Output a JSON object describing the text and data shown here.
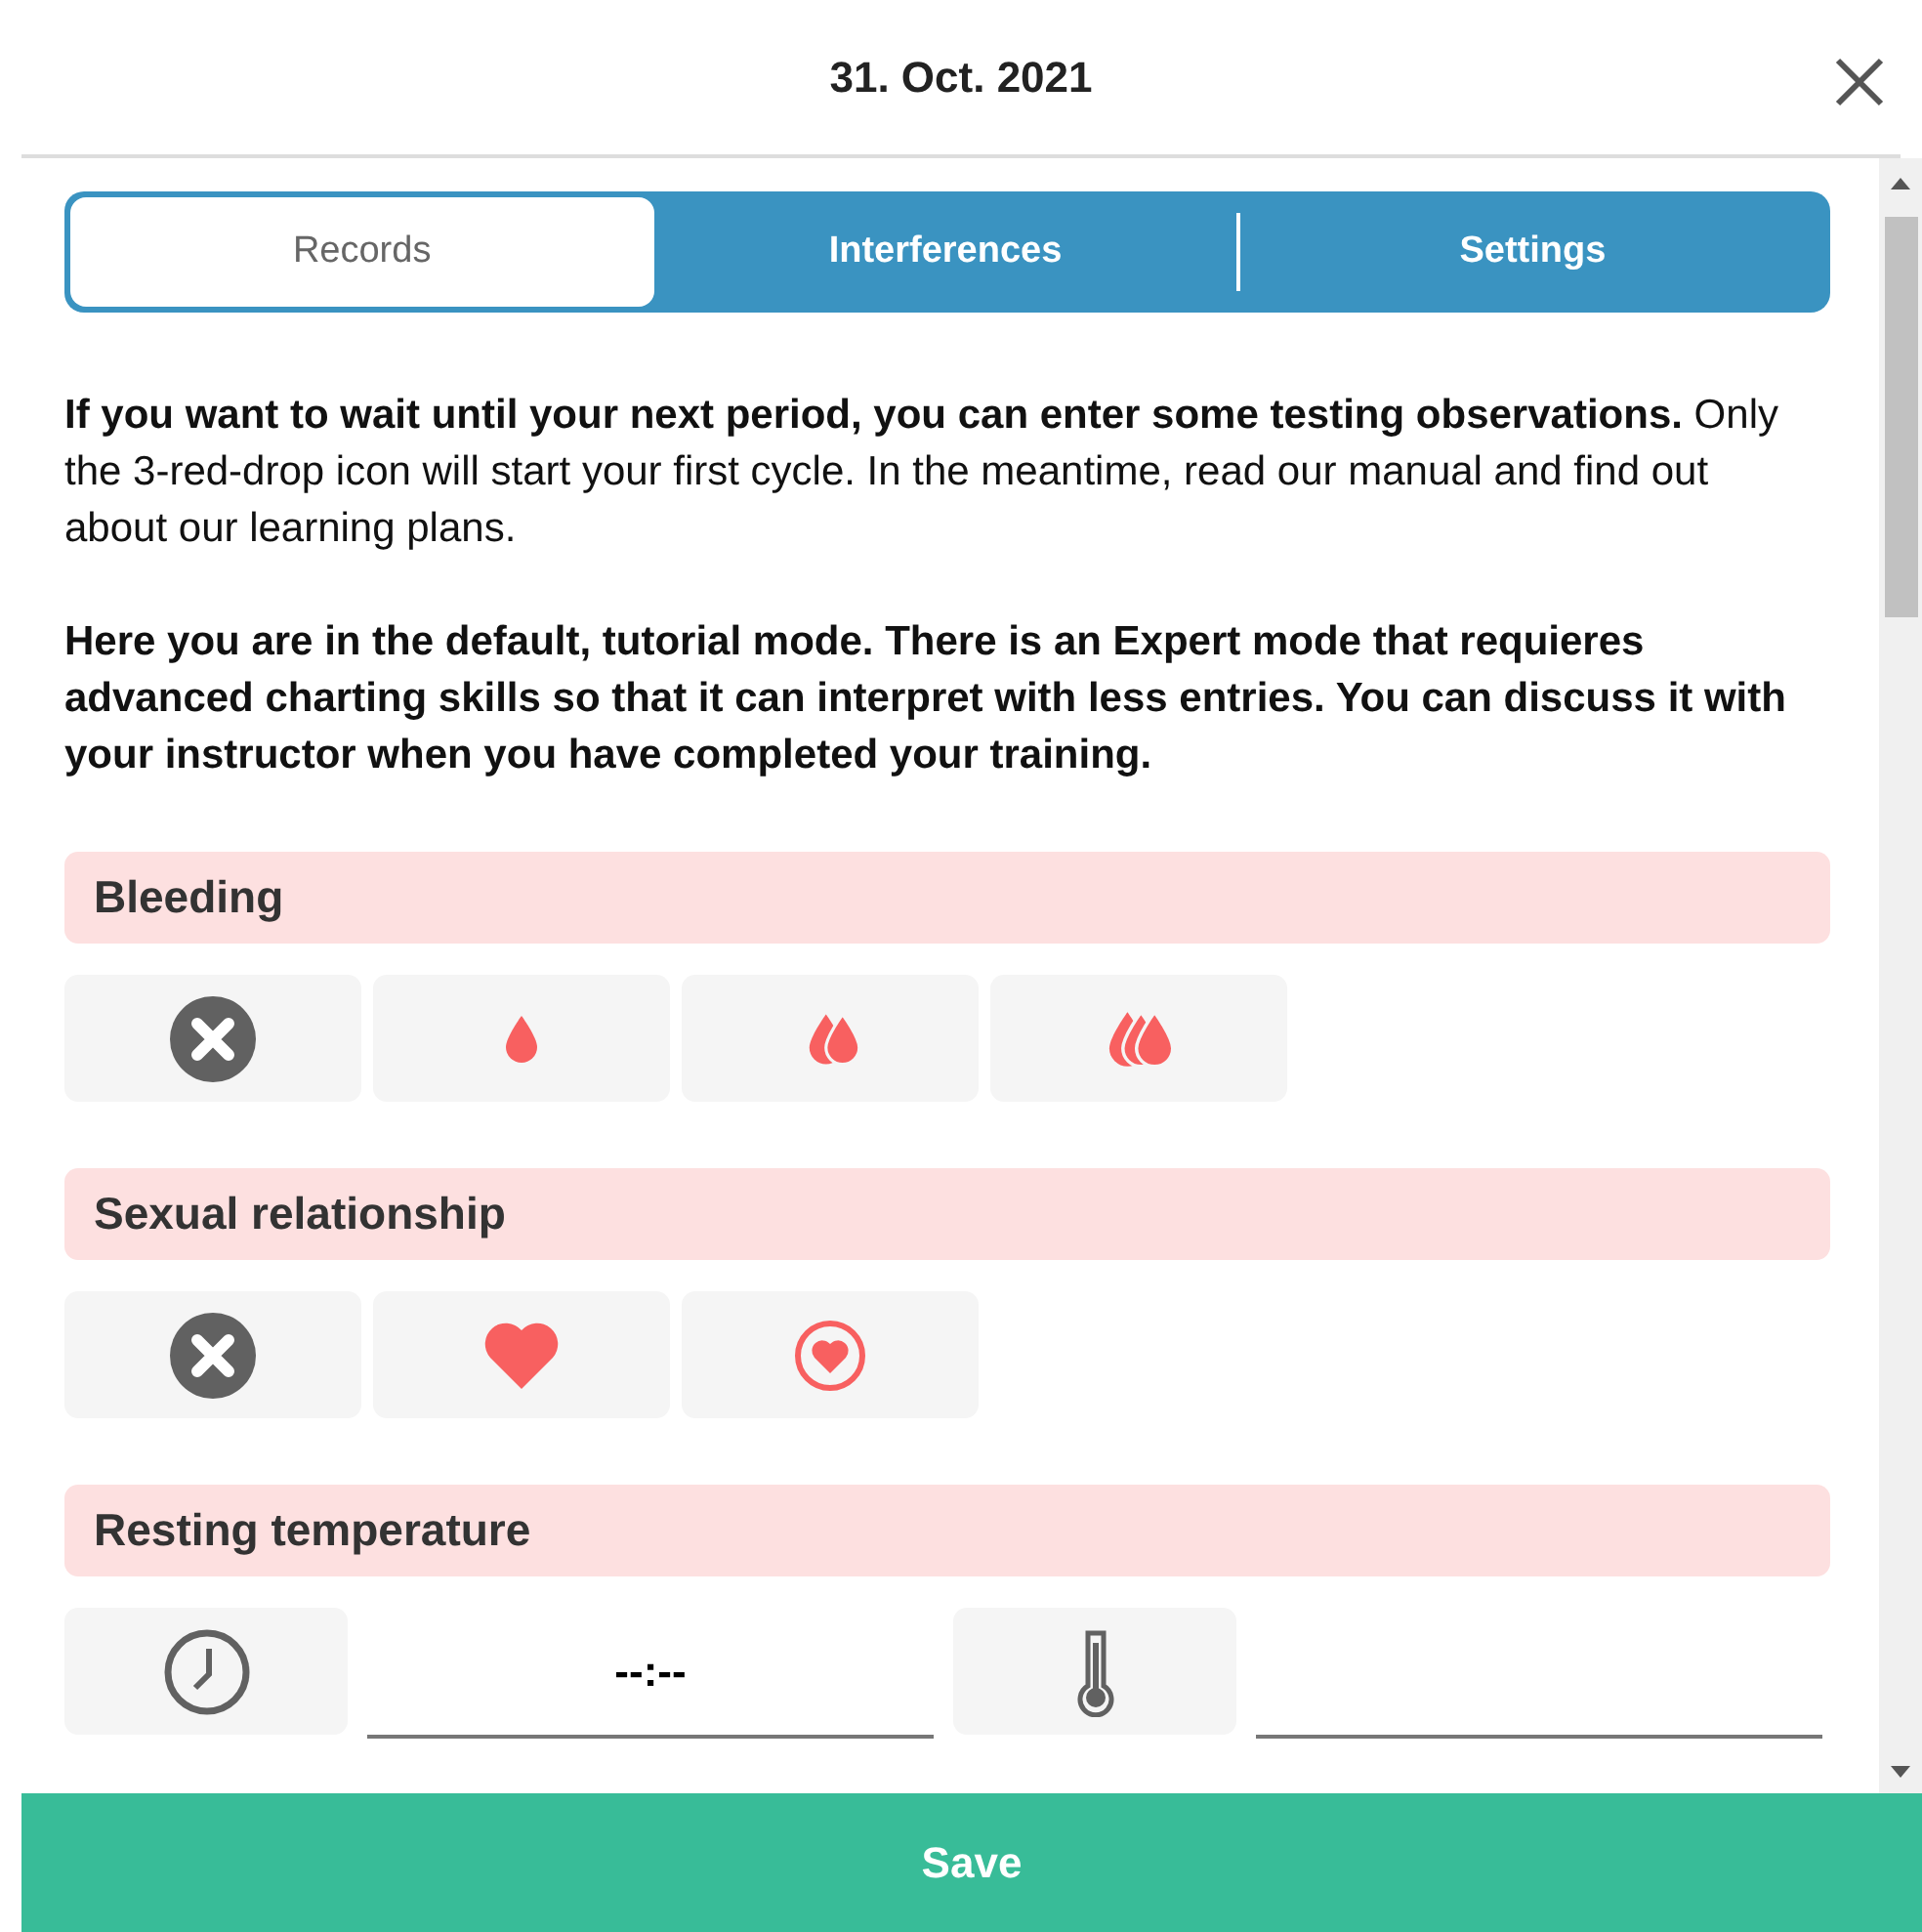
{
  "header": {
    "title": "31. Oct. 2021"
  },
  "tabs": [
    {
      "label": "Records",
      "selected": true
    },
    {
      "label": "Interferences",
      "selected": false
    },
    {
      "label": "Settings",
      "selected": false
    }
  ],
  "intro": [
    "**If you want to wait until your next period, you can enter some testing observations.** Only the 3-red-drop icon will start your first cycle. In the meantime, read our manual and find out about our learning plans.",
    "**Here you are in the default, tutorial mode. There is an Expert mode that requieres advanced charting skills so that it can interpret with less entries. You can discuss it with your instructor when you have completed your training.**"
  ],
  "sections": [
    {
      "title": "Bleeding",
      "options": [
        {
          "kind": "none"
        },
        {
          "kind": "drop1"
        },
        {
          "kind": "drop2"
        },
        {
          "kind": "drop3"
        }
      ]
    },
    {
      "title": "Sexual relationship",
      "options": [
        {
          "kind": "none"
        },
        {
          "kind": "heart"
        },
        {
          "kind": "heart-circle"
        }
      ]
    }
  ],
  "temperature": {
    "title": "Resting temperature",
    "time": {
      "value": "--:--"
    }
  },
  "save_button": "Save"
}
